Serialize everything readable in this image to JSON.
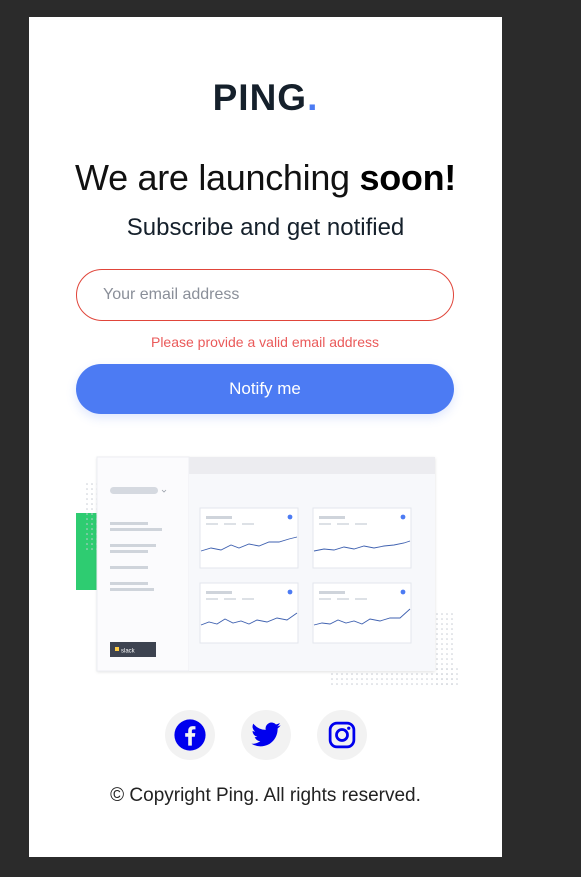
{
  "logo": {
    "text": "PING",
    "dot": "."
  },
  "headline": {
    "normal": "We are launching ",
    "bold": "soon!"
  },
  "subheading": "Subscribe and get notified",
  "email": {
    "placeholder": "Your email address",
    "value": ""
  },
  "error_message": "Please provide a valid email address",
  "notify_label": "Notify me",
  "dashboard": {
    "brand_badge": "slack"
  },
  "socials": [
    {
      "name": "facebook-icon"
    },
    {
      "name": "twitter-icon"
    },
    {
      "name": "instagram-icon"
    }
  ],
  "copyright": "© Copyright Ping. All rights reserved.",
  "colors": {
    "accent": "#4c7bf3",
    "error": "#ea5a5a",
    "dark": "#15202b",
    "green": "#2ecc71",
    "icon_blue": "#0000ee"
  }
}
